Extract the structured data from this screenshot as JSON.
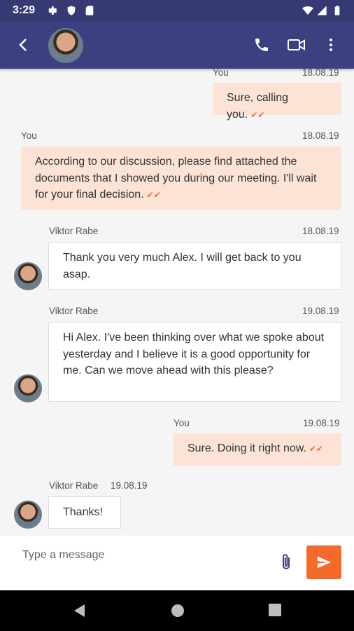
{
  "status_bar": {
    "time": "3:29"
  },
  "header": {
    "contact_avatar": "Viktor Rabe avatar"
  },
  "messages": [
    {
      "sender": "You",
      "date": "18.08.19",
      "text": "Sure, calling you.",
      "direction": "out"
    },
    {
      "sender": "You",
      "date": "18.08.19",
      "text": "According to our discussion, please find attached the documents that I showed you during our meeting. I'll wait for your final decision.",
      "direction": "out"
    },
    {
      "sender": "Viktor Rabe",
      "date": "18.08.19",
      "text": "Thank you very much Alex. I will get back to you asap.",
      "direction": "in"
    },
    {
      "sender": "Viktor Rabe",
      "date": "19.08.19",
      "text": "Hi Alex. I've been thinking over what we spoke about yesterday and I believe it is a good opportunity for me. Can we move ahead with this please?",
      "direction": "in"
    },
    {
      "sender": "You",
      "date": "19.08.19",
      "text": "Sure. Doing it right now.",
      "direction": "out"
    },
    {
      "sender": "Viktor Rabe",
      "date": "19.08.19",
      "text": "Thanks!",
      "direction": "in"
    }
  ],
  "composer": {
    "placeholder": "Type a message"
  },
  "icons": {
    "back": "arrow-left-icon",
    "call": "phone-icon",
    "video": "video-icon",
    "menu": "more-vertical-icon",
    "attach": "paperclip-icon",
    "send": "send-icon",
    "read": "double-check-icon"
  },
  "colors": {
    "header": "#3b4180",
    "accent": "#f56a2a",
    "outgoing_bubble": "#fde3d6",
    "incoming_bubble": "#ffffff"
  }
}
